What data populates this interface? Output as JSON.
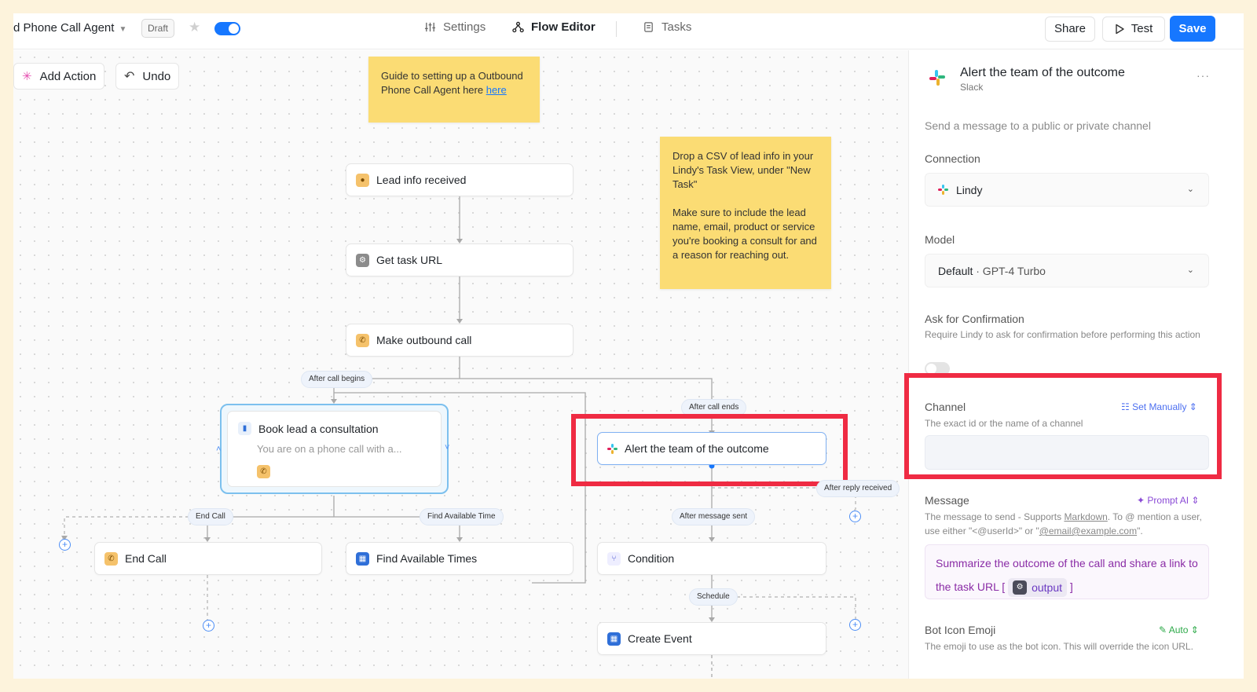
{
  "topbar": {
    "title": "d Phone Call Agent",
    "status_badge": "Draft",
    "tabs": [
      {
        "label": "Settings",
        "icon": "sliders-icon"
      },
      {
        "label": "Flow Editor",
        "icon": "flow-icon"
      },
      {
        "label": "Tasks",
        "icon": "tasks-icon"
      }
    ],
    "share_label": "Share",
    "test_label": "Test",
    "save_label": "Save",
    "accent_color": "#1677ff"
  },
  "canvas": {
    "add_action_label": "Add Action",
    "undo_label": "Undo",
    "note1": {
      "text": "Guide to setting up a Outbound Phone Call Agent here ",
      "link": "here"
    },
    "note2": {
      "para1": "Drop a CSV of lead info in your Lindy's Task View, under \"New Task\"",
      "para2": "Make sure to include the lead name, email, product or service you're booking a consult for and a reason for reaching out."
    },
    "nodes": {
      "lead_info": "Lead info received",
      "get_task_url": "Get task URL",
      "make_call": "Make outbound call",
      "book_lead": "Book lead a consultation",
      "book_lead_preview": "You are on a phone call with a...",
      "alert_team": "Alert the team of the outcome",
      "end_call": "End Call",
      "find_times": "Find Available Times",
      "condition": "Condition",
      "create_event": "Create Event"
    },
    "edge_labels": {
      "after_call_begins": "After call begins",
      "after_call_ends": "After call ends",
      "after_reply_received": "After reply received",
      "end_call": "End Call",
      "find_available_time": "Find Available Time",
      "after_message_sent": "After message sent",
      "schedule": "Schedule"
    }
  },
  "panel": {
    "title": "Alert the team of the outcome",
    "subtitle": "Slack",
    "description": "Send a message to a public or private channel",
    "connection": {
      "label": "Connection",
      "value": "Lindy"
    },
    "model": {
      "label": "Model",
      "value_bold": "Default",
      "value_rest": " · GPT-4 Turbo"
    },
    "confirmation": {
      "label": "Ask for Confirmation",
      "help": "Require Lindy to ask for confirmation before performing this action"
    },
    "channel": {
      "label": "Channel",
      "help": "The exact id or the name of a channel",
      "mode": "Set Manually",
      "value": ""
    },
    "message": {
      "label": "Message",
      "mode": "Prompt AI",
      "help_prefix": "The message to send - Supports ",
      "help_link": "Markdown",
      "help_mid": ". To @ mention a user, use either \"<@userId>\" or \"",
      "help_email": "@email@example.com",
      "help_suffix": "\".",
      "value": "Summarize the outcome of the call and share a link to the task URL [",
      "chip": "output",
      "value_end": "]"
    },
    "bot_icon": {
      "label": "Bot Icon Emoji",
      "mode": "Auto",
      "help": "The emoji to use as the bot icon. This will override the icon URL."
    }
  }
}
